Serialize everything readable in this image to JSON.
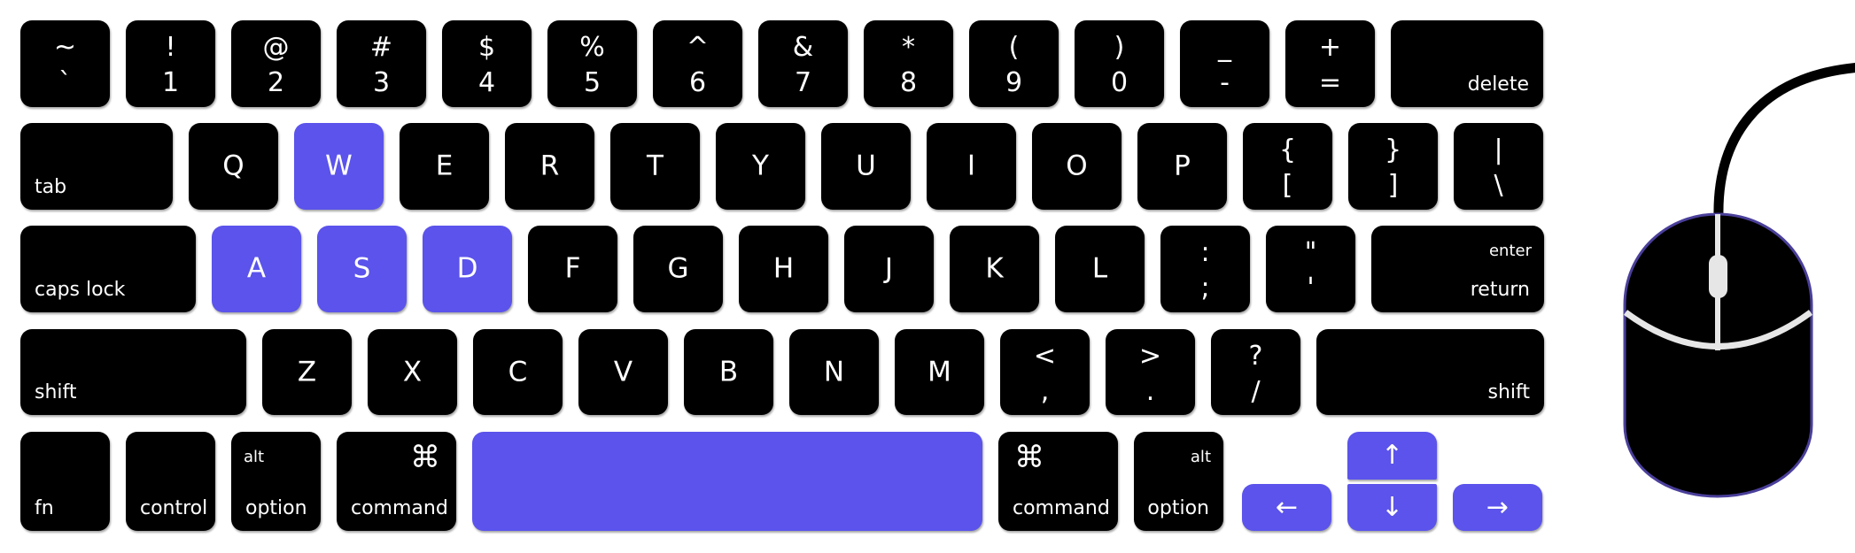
{
  "colors": {
    "key": "#000000",
    "highlight": "#5B53EB",
    "legend": "#ffffff",
    "mouse_outline": "#4A3F9A",
    "mouse_accent": "#E6E6E6",
    "background": "#ffffff"
  },
  "keyboard": {
    "rows": [
      {
        "name": "number-row",
        "keys": [
          {
            "id": "backtick",
            "top": "~",
            "bot": "`"
          },
          {
            "id": "1",
            "top": "!",
            "bot": "1"
          },
          {
            "id": "2",
            "top": "@",
            "bot": "2"
          },
          {
            "id": "3",
            "top": "#",
            "bot": "3"
          },
          {
            "id": "4",
            "top": "$",
            "bot": "4"
          },
          {
            "id": "5",
            "top": "%",
            "bot": "5"
          },
          {
            "id": "6",
            "top": "^",
            "bot": "6"
          },
          {
            "id": "7",
            "top": "&",
            "bot": "7"
          },
          {
            "id": "8",
            "top": "*",
            "bot": "8"
          },
          {
            "id": "9",
            "top": "(",
            "bot": "9"
          },
          {
            "id": "0",
            "top": ")",
            "bot": "0"
          },
          {
            "id": "minus",
            "top": "_",
            "bot": "-"
          },
          {
            "id": "equals",
            "top": "+",
            "bot": "="
          },
          {
            "id": "delete",
            "label": "delete",
            "align": "right"
          }
        ]
      },
      {
        "name": "qwerty-row",
        "keys": [
          {
            "id": "tab",
            "label": "tab",
            "align": "left"
          },
          {
            "id": "q",
            "main": "Q"
          },
          {
            "id": "w",
            "main": "W",
            "highlighted": true
          },
          {
            "id": "e",
            "main": "E"
          },
          {
            "id": "r",
            "main": "R"
          },
          {
            "id": "t",
            "main": "T"
          },
          {
            "id": "y",
            "main": "Y"
          },
          {
            "id": "u",
            "main": "U"
          },
          {
            "id": "i",
            "main": "I"
          },
          {
            "id": "o",
            "main": "O"
          },
          {
            "id": "p",
            "main": "P"
          },
          {
            "id": "lbracket",
            "top": "{",
            "bot": "["
          },
          {
            "id": "rbracket",
            "top": "}",
            "bot": "]"
          },
          {
            "id": "backslash",
            "top": "|",
            "bot": "\\"
          }
        ]
      },
      {
        "name": "home-row",
        "keys": [
          {
            "id": "capslock",
            "label": "caps lock",
            "align": "left"
          },
          {
            "id": "a",
            "main": "A",
            "highlighted": true
          },
          {
            "id": "s",
            "main": "S",
            "highlighted": true
          },
          {
            "id": "d",
            "main": "D",
            "highlighted": true
          },
          {
            "id": "f",
            "main": "F"
          },
          {
            "id": "g",
            "main": "G"
          },
          {
            "id": "h",
            "main": "H"
          },
          {
            "id": "j",
            "main": "J"
          },
          {
            "id": "k",
            "main": "K"
          },
          {
            "id": "l",
            "main": "L"
          },
          {
            "id": "semicolon",
            "top": ":",
            "bot": ";"
          },
          {
            "id": "quote",
            "top": "\"",
            "bot": "'"
          },
          {
            "id": "return",
            "label": "return",
            "sublabel": "enter",
            "align": "right"
          }
        ]
      },
      {
        "name": "shift-row",
        "keys": [
          {
            "id": "lshift",
            "label": "shift",
            "align": "left"
          },
          {
            "id": "z",
            "main": "Z"
          },
          {
            "id": "x",
            "main": "X"
          },
          {
            "id": "c",
            "main": "C"
          },
          {
            "id": "v",
            "main": "V"
          },
          {
            "id": "b",
            "main": "B"
          },
          {
            "id": "n",
            "main": "N"
          },
          {
            "id": "m",
            "main": "M"
          },
          {
            "id": "comma",
            "top": "<",
            "bot": ","
          },
          {
            "id": "period",
            "top": ">",
            "bot": "."
          },
          {
            "id": "slash",
            "top": "?",
            "bot": "/"
          },
          {
            "id": "rshift",
            "label": "shift",
            "align": "right"
          }
        ]
      },
      {
        "name": "modifier-row",
        "keys": [
          {
            "id": "fn",
            "label": "fn",
            "align": "left"
          },
          {
            "id": "lcontrol",
            "label": "control",
            "align": "left"
          },
          {
            "id": "loption",
            "label": "option",
            "sublabel": "alt",
            "align": "left"
          },
          {
            "id": "lcommand",
            "label": "command",
            "symbol": "⌘",
            "align": "left",
            "symbol_align": "right"
          },
          {
            "id": "space",
            "label": "",
            "highlighted": true
          },
          {
            "id": "rcommand",
            "label": "command",
            "symbol": "⌘",
            "align": "left",
            "symbol_align": "left"
          },
          {
            "id": "roption",
            "label": "option",
            "sublabel": "alt",
            "align": "right"
          },
          {
            "id": "left",
            "arrow": "←",
            "highlighted": true
          },
          {
            "id": "up",
            "arrow": "↑",
            "highlighted": true
          },
          {
            "id": "down",
            "arrow": "↓",
            "highlighted": true
          },
          {
            "id": "right",
            "arrow": "→",
            "highlighted": true
          }
        ]
      }
    ]
  },
  "mouse": {
    "name": "wired-mouse",
    "highlighted_parts": [
      "outline"
    ]
  }
}
